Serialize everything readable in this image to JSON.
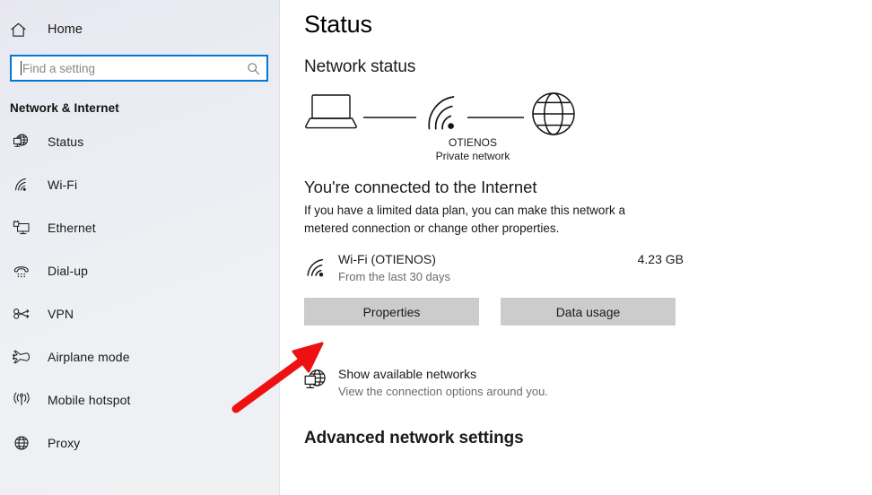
{
  "sidebar": {
    "home": {
      "label": "Home",
      "icon": "home-icon"
    },
    "search": {
      "placeholder": "Find a setting",
      "value": "",
      "icon": "search-icon"
    },
    "section_title": "Network & Internet",
    "items": [
      {
        "label": "Status",
        "icon": "network-status-globe-icon",
        "selected": true
      },
      {
        "label": "Wi-Fi",
        "icon": "wifi-icon",
        "selected": false
      },
      {
        "label": "Ethernet",
        "icon": "ethernet-monitor-icon",
        "selected": false
      },
      {
        "label": "Dial-up",
        "icon": "dialup-phone-icon",
        "selected": false
      },
      {
        "label": "VPN",
        "icon": "vpn-key-icon",
        "selected": false
      },
      {
        "label": "Airplane mode",
        "icon": "airplane-icon",
        "selected": false
      },
      {
        "label": "Mobile hotspot",
        "icon": "mobile-hotspot-icon",
        "selected": false
      },
      {
        "label": "Proxy",
        "icon": "globe-icon",
        "selected": false
      }
    ]
  },
  "main": {
    "page_title": "Status",
    "network_status_heading": "Network status",
    "diagram": {
      "device_icon": "laptop-icon",
      "link_icon": "wifi-icon",
      "internet_icon": "globe-icon",
      "network_name": "OTIENOS",
      "network_type": "Private network"
    },
    "connection": {
      "heading": "You're connected to the Internet",
      "description": "If you have a limited data plan, you can make this network a metered connection or change other properties."
    },
    "adapter": {
      "icon": "wifi-icon",
      "name": "Wi-Fi (OTIENOS)",
      "subtitle": "From the last 30 days",
      "usage": "4.23 GB"
    },
    "buttons": [
      {
        "label": "Properties",
        "name": "properties-button"
      },
      {
        "label": "Data usage",
        "name": "data-usage-button"
      }
    ],
    "show_available": {
      "icon": "network-status-globe-icon",
      "title": "Show available networks",
      "subtitle": "View the connection options around you."
    },
    "advanced_heading": "Advanced network settings"
  },
  "annotation": {
    "type": "arrow",
    "color": "#ee1111",
    "points_to": "properties-button"
  },
  "colors": {
    "accent": "#0078d7",
    "button_face": "#cccccc",
    "annotation_red": "#ee1111",
    "sidebar_bg": "#ebecf2",
    "content_bg": "#ffffff",
    "muted_text": "#6b6b6b"
  }
}
